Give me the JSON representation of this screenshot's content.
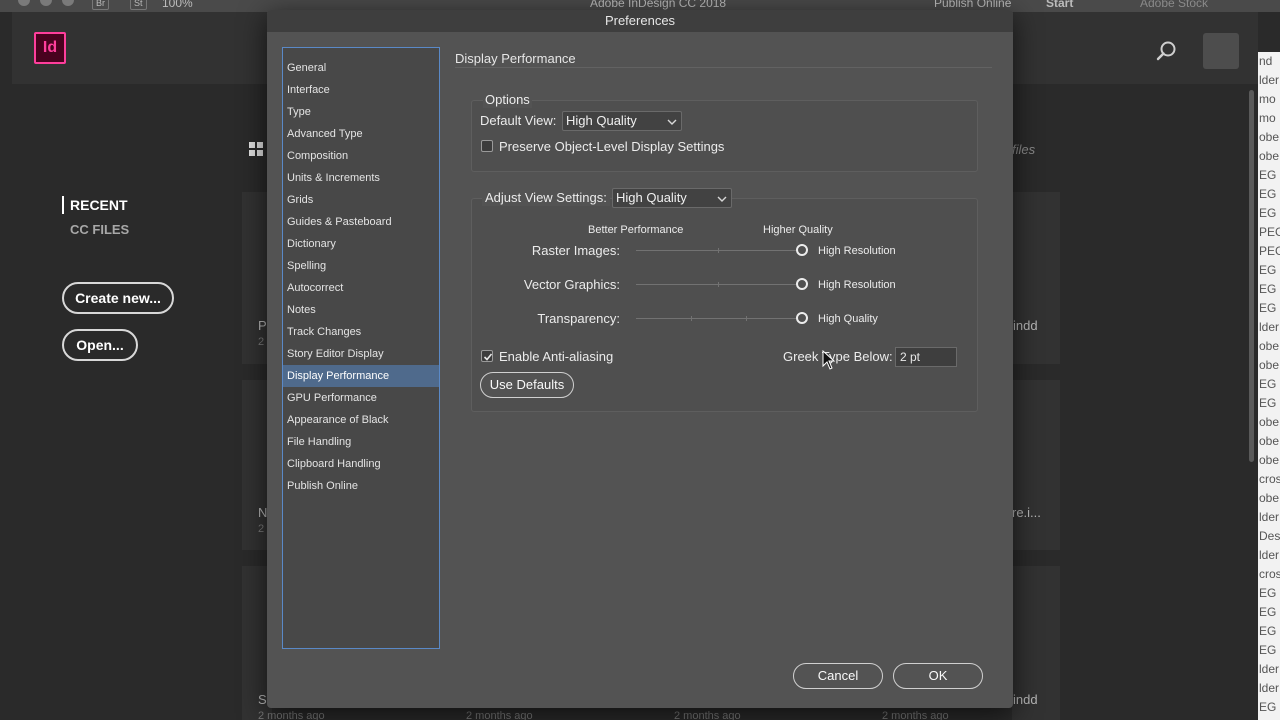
{
  "menubar": {
    "bridge_label": "Br",
    "stock_label": "St",
    "zoom_value": "100%",
    "app_title": "Adobe InDesign CC 2018",
    "publish_online_label": "Publish Online",
    "workspace_label": "Start",
    "adobe_stock_search_placeholder": "Adobe Stock"
  },
  "home": {
    "logo_text": "Id",
    "nav": {
      "recent": "RECENT",
      "cc_files": "CC FILES"
    },
    "create_new_label": "Create new...",
    "open_label": "Open...",
    "files_hint": "files",
    "tiles": [
      {
        "peek": "Pe",
        "sub": "2",
        "right_peek": "indd"
      },
      {
        "peek": "N",
        "sub": "2",
        "right_peek": "re.i..."
      },
      {
        "peek": "Sa",
        "sub": "2 months ago",
        "right_peek": "indd"
      }
    ],
    "tile_dates": [
      "2 months ago",
      "2 months ago",
      "2 months ago",
      "2 months ago"
    ]
  },
  "right_doc_lines": [
    "nd",
    "lder",
    "mo",
    "mo",
    "obe",
    "obe",
    "EG i",
    "EG i",
    "EG i",
    "PEG",
    "PEG",
    "EG i",
    "EG i",
    "EG i",
    "lder",
    "obe",
    "obe",
    "EG i",
    "EG i",
    "obe",
    "obe",
    "obe",
    "cros",
    "obe",
    "lder",
    "Desi",
    "lder",
    "cros",
    "EG i",
    "EG i",
    "EG i",
    "EG i",
    "lder",
    "lder",
    "EG i"
  ],
  "dialog": {
    "title": "Preferences",
    "categories": [
      "General",
      "Interface",
      "Type",
      "Advanced Type",
      "Composition",
      "Units & Increments",
      "Grids",
      "Guides & Pasteboard",
      "Dictionary",
      "Spelling",
      "Autocorrect",
      "Notes",
      "Track Changes",
      "Story Editor Display",
      "Display Performance",
      "GPU Performance",
      "Appearance of Black",
      "File Handling",
      "Clipboard Handling",
      "Publish Online"
    ],
    "selected_category": "Display Performance",
    "pane_title": "Display Performance",
    "options": {
      "group_label": "Options",
      "default_view_label": "Default View:",
      "default_view_value": "High Quality",
      "preserve_label": "Preserve Object-Level Display Settings",
      "preserve_checked": false
    },
    "adjust": {
      "label": "Adjust View Settings:",
      "value": "High Quality",
      "better_performance": "Better Performance",
      "higher_quality": "Higher Quality",
      "sliders": [
        {
          "label": "Raster Images:",
          "value_label": "High Resolution",
          "level": 1.0
        },
        {
          "label": "Vector Graphics:",
          "value_label": "High Resolution",
          "level": 1.0
        },
        {
          "label": "Transparency:",
          "value_label": "High Quality",
          "level": 1.0
        }
      ],
      "anti_aliasing_label": "Enable Anti-aliasing",
      "anti_aliasing_checked": true,
      "greek_type_label": "Greek Type Below:",
      "greek_type_value": "2 pt",
      "use_defaults_label": "Use Defaults"
    },
    "cancel_label": "Cancel",
    "ok_label": "OK"
  }
}
